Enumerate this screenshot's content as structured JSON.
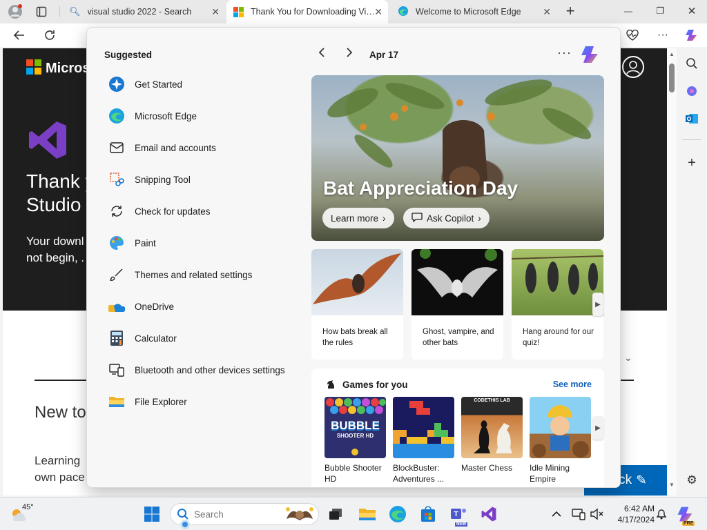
{
  "browser": {
    "tabs": [
      {
        "title": "visual studio 2022 - Search",
        "active": false
      },
      {
        "title": "Thank You for Downloading Visu",
        "active": true
      },
      {
        "title": "Welcome to Microsoft Edge",
        "active": false
      }
    ],
    "new_tab_label": "+",
    "window_controls": {
      "minimize": "—",
      "restore": "❐",
      "close": "✕"
    }
  },
  "page": {
    "brand": "Microso",
    "heading_line1": "Thank y",
    "heading_line2": "Studio",
    "para_line1": "Your downl",
    "para_line2": "not begin, .",
    "section_heading": "New to",
    "section_para_line1": "Learning",
    "section_para_line2": "own pace",
    "feedback_label": "back"
  },
  "flyout": {
    "suggested_title": "Suggested",
    "suggested": [
      {
        "label": "Get Started",
        "icon": "get-started-icon"
      },
      {
        "label": "Microsoft Edge",
        "icon": "edge-icon"
      },
      {
        "label": "Email and accounts",
        "icon": "mail-icon"
      },
      {
        "label": "Snipping Tool",
        "icon": "snipping-tool-icon"
      },
      {
        "label": "Check for updates",
        "icon": "refresh-icon"
      },
      {
        "label": "Paint",
        "icon": "paint-icon"
      },
      {
        "label": "Themes and related settings",
        "icon": "brush-icon"
      },
      {
        "label": "OneDrive",
        "icon": "onedrive-icon"
      },
      {
        "label": "Calculator",
        "icon": "calculator-icon"
      },
      {
        "label": "Bluetooth and other devices settings",
        "icon": "bluetooth-devices-icon"
      },
      {
        "label": "File Explorer",
        "icon": "folder-icon"
      }
    ],
    "widgets": {
      "date": "Apr 17",
      "more": "···",
      "hero_title": "Bat Appreciation Day",
      "learn_more": "Learn more",
      "ask_copilot": "Ask Copilot",
      "cards": [
        {
          "caption": "How bats break all the rules"
        },
        {
          "caption": "Ghost, vampire, and other bats"
        },
        {
          "caption": "Hang around for our quiz!"
        }
      ],
      "games_title": "Games for you",
      "see_more": "See more",
      "games": [
        {
          "name": "Bubble Shooter HD",
          "art_text": "BUBBLE",
          "art_sub": "SHOOTER HD"
        },
        {
          "name": "BlockBuster: Adventures ..."
        },
        {
          "name": "Master Chess",
          "art_text": "CODETHIS LAB"
        },
        {
          "name": "Idle Mining Empire"
        }
      ]
    }
  },
  "taskbar": {
    "weather_temp": "45°",
    "search_placeholder": "Search",
    "time": "6:42 AM",
    "date": "4/17/2024",
    "new_badge": "NEW",
    "pre_badge": "PRE"
  },
  "colors": {
    "accent": "#0067b8",
    "link": "#0f5fb8",
    "hero_dark": "#1e1e1e",
    "vs_purple": "#7b3fc5"
  }
}
